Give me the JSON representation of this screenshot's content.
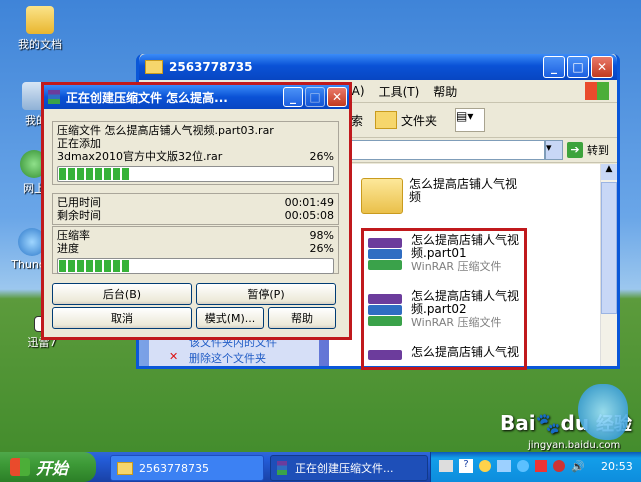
{
  "desktop": {
    "icons": [
      {
        "label": "我的文档"
      },
      {
        "label": "我的"
      },
      {
        "label": "网上"
      },
      {
        "label": "Thunde"
      },
      {
        "label": "迅雷7"
      }
    ],
    "watermark": {
      "logo": "Bai",
      "logo2": "du",
      "text": "经验",
      "url": "jingyan.baidu.com"
    }
  },
  "explorer": {
    "title": "2563778735",
    "menu": [
      "(A)",
      "工具(T)",
      "帮助"
    ],
    "menu_labels": {
      "a": "(A)",
      "tools": "工具(T)",
      "help": "帮助"
    },
    "toolbar": {
      "search": "搜索",
      "folders": "文件夹"
    },
    "go_label": "转到",
    "tasks": [
      "该文件夹内的文件",
      "删除这个文件夹"
    ],
    "files": [
      {
        "name": "怎么提高店铺人气视频",
        "type": ""
      },
      {
        "name": "怎么提高店铺人气视频.part01",
        "type": "WinRAR 压缩文件"
      },
      {
        "name": "怎么提高店铺人气视频.part02",
        "type": "WinRAR 压缩文件"
      },
      {
        "name": "怎么提高店铺人气视",
        "type": ""
      }
    ]
  },
  "dialog": {
    "title": "正在创建压缩文件 怎么提高...",
    "archive_line": "压缩文件 怎么提高店铺人气视频.part03.rar",
    "adding_line": "正在添加",
    "current_file": "3dmax2010官方中文版32位.rar",
    "current_percent": "26%",
    "current_progress": 0.26,
    "elapsed_label": "已用时间",
    "elapsed_value": "00:01:49",
    "remaining_label": "剩余时间",
    "remaining_value": "00:05:08",
    "ratio_label": "压缩率",
    "ratio_value": "98%",
    "progress_label": "进度",
    "progress_value": "26%",
    "total_progress": 0.26,
    "buttons": {
      "background": "后台(B)",
      "pause": "暂停(P)",
      "cancel": "取消",
      "mode": "模式(M)...",
      "help": "帮助"
    }
  },
  "taskbar": {
    "start": "开始",
    "tasks": [
      {
        "label": "2563778735"
      },
      {
        "label": "正在创建压缩文件..."
      }
    ],
    "clock": "20:53"
  }
}
